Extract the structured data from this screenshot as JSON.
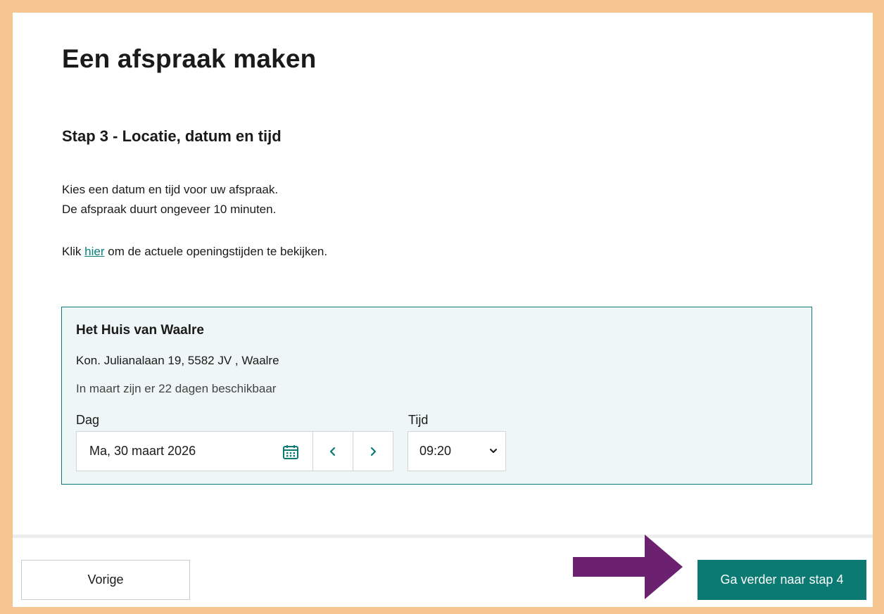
{
  "page": {
    "title": "Een afspraak maken",
    "step_title": "Stap 3 - Locatie, datum en tijd",
    "intro_line1": "Kies een datum en tijd voor uw afspraak.",
    "intro_line2": "De afspraak duurt ongeveer 10 minuten.",
    "hours_prefix": "Klik",
    "hours_link": "hier",
    "hours_suffix": "om de actuele openingstijden te bekijken."
  },
  "location": {
    "name": "Het Huis van Waalre",
    "address": "Kon. Julianalaan 19, 5582 JV , Waalre",
    "availability": "In maart zijn er 22 dagen beschikbaar",
    "day_label": "Dag",
    "day_value": "Ma, 30 maart 2026",
    "time_label": "Tijd",
    "time_value": "09:20"
  },
  "footer": {
    "prev_label": "Vorige",
    "next_label": "Ga verder naar stap 4"
  },
  "icons": {
    "calendar": "calendar-icon",
    "prev": "chevron-left-icon",
    "next": "chevron-right-icon",
    "dropdown": "chevron-down-icon",
    "arrow": "arrow-right-icon"
  },
  "colors": {
    "accent": "#0a7a73",
    "link": "#0a7f7d",
    "panel_bg": "#eef6f6",
    "frame": "#f5c68f",
    "arrow": "#6b2170"
  }
}
